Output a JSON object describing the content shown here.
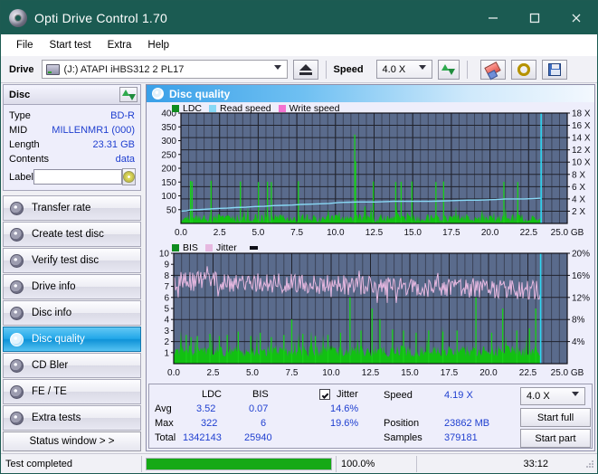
{
  "window": {
    "title": "Opti Drive Control 1.70",
    "icon": "disc-icon",
    "buttons": {
      "minimize": "minimize-icon",
      "maximize": "maximize-icon",
      "close": "close-icon"
    }
  },
  "menu": {
    "items": [
      "File",
      "Start test",
      "Extra",
      "Help"
    ]
  },
  "toolbar": {
    "drive_label": "Drive",
    "drive_value": "(J:)   ATAPI iHBS312   2 PL17",
    "eject_icon": "eject-icon",
    "speed_label": "Speed",
    "speed_value": "4.0 X",
    "refresh_icon": "refresh-arrows-icon",
    "erase_icon": "eraser-icon",
    "tools_icon": "wrench-icon",
    "save_icon": "floppy-save-icon"
  },
  "disc": {
    "header": "Disc",
    "refresh_icon": "refresh-arrows-icon",
    "rows": [
      {
        "key": "Type",
        "value": "BD-R"
      },
      {
        "key": "MID",
        "value": "MILLENMR1 (000)"
      },
      {
        "key": "Length",
        "value": "23.31 GB"
      },
      {
        "key": "Contents",
        "value": "data"
      }
    ],
    "label_key": "Label",
    "label_value": "",
    "label_placeholder": "",
    "label_button_icon": "disc-icon"
  },
  "nav": {
    "items": [
      {
        "label": "Transfer rate",
        "icon": "disc-icon",
        "active": false
      },
      {
        "label": "Create test disc",
        "icon": "disc-icon",
        "active": false
      },
      {
        "label": "Verify test disc",
        "icon": "disc-icon",
        "active": false
      },
      {
        "label": "Drive info",
        "icon": "disc-icon",
        "active": false
      },
      {
        "label": "Disc info",
        "icon": "disc-icon",
        "active": false
      },
      {
        "label": "Disc quality",
        "icon": "disc-icon",
        "active": true
      },
      {
        "label": "CD Bler",
        "icon": "disc-icon",
        "active": false
      },
      {
        "label": "FE / TE",
        "icon": "disc-icon",
        "active": false
      },
      {
        "label": "Extra tests",
        "icon": "disc-icon",
        "active": false
      }
    ],
    "status_window": "Status window > >"
  },
  "panel": {
    "title": "Disc quality",
    "icon": "disc-icon"
  },
  "stats": {
    "col_ldc": "LDC",
    "col_bis": "BIS",
    "jitter_label": "Jitter",
    "jitter_checked": true,
    "row_avg": "Avg",
    "row_max": "Max",
    "row_total": "Total",
    "ldc_avg": "3.52",
    "ldc_max": "322",
    "ldc_total": "1342143",
    "bis_avg": "0.07",
    "bis_max": "6",
    "bis_total": "25940",
    "jitter_avg": "14.6%",
    "jitter_max": "19.6%",
    "speed_label": "Speed",
    "speed_value": "4.19 X",
    "position_label": "Position",
    "position_value": "23862 MB",
    "samples_label": "Samples",
    "samples_value": "379181",
    "speed_select": "4.0 X",
    "start_full": "Start full",
    "start_part": "Start part"
  },
  "statusbar": {
    "message": "Test completed",
    "progress_percent": 100.0,
    "progress_text": "100.0%",
    "elapsed": "33:12"
  },
  "colors": {
    "titlebar": "#1b5b52",
    "accent": "#1f3fd0",
    "ldc_green": "#12c012",
    "bis_green": "#12c012",
    "read_speed": "#88d8f5",
    "write_speed": "#f472d0",
    "jitter_pink": "#e6b8e0",
    "plot_bg": "#5a6b8c",
    "grid": "#20222c",
    "progress": "#16a916"
  },
  "chart_data": [
    {
      "type": "line",
      "id": "ldc-chart",
      "title": "",
      "xlabel": "GB",
      "ylabel": "",
      "xlim": [
        0,
        25
      ],
      "xticks": [
        0.0,
        2.5,
        5.0,
        7.5,
        10.0,
        12.5,
        15.0,
        17.5,
        20.0,
        22.5,
        25.0
      ],
      "xticklabels": [
        "0.0",
        "2.5",
        "5.0",
        "7.5",
        "10.0",
        "12.5",
        "15.0",
        "17.5",
        "20.0",
        "22.5",
        "25.0 GB"
      ],
      "ylim": [
        0,
        400
      ],
      "yticks": [
        50,
        100,
        150,
        200,
        250,
        300,
        350,
        400
      ],
      "yticklabels": [
        "50",
        "100",
        "150",
        "200",
        "250",
        "300",
        "350",
        "400"
      ],
      "y2lim": [
        0,
        18
      ],
      "y2ticks": [
        2,
        4,
        6,
        8,
        10,
        12,
        14,
        16,
        18
      ],
      "y2ticklabels": [
        "2 X",
        "4 X",
        "6 X",
        "8 X",
        "10 X",
        "12 X",
        "14 X",
        "16 X",
        "18 X"
      ],
      "legend": [
        "LDC",
        "Read speed",
        "Write speed"
      ],
      "legend_colors": [
        "#0f8c1f",
        "#88d8f5",
        "#f472d0"
      ],
      "legend_position": "top-left",
      "grid": true,
      "data_end_gb": 23.31,
      "series": [
        {
          "name": "LDC",
          "kind": "bars",
          "note": "dense noise floor ~5-35 with sparse spikes",
          "baseline_min": 4,
          "baseline_max": 36,
          "spikes": [
            [
              0.62,
              154
            ],
            [
              0.72,
              152
            ],
            [
              1.95,
              155
            ],
            [
              3.85,
              152
            ],
            [
              5.02,
              150
            ],
            [
              5.6,
              151
            ],
            [
              5.85,
              150
            ],
            [
              7.6,
              153
            ],
            [
              11.25,
              322
            ],
            [
              11.3,
              225
            ],
            [
              12.45,
              152
            ],
            [
              13.9,
              150
            ],
            [
              14.25,
              151
            ],
            [
              14.95,
              152
            ],
            [
              16.5,
              150
            ],
            [
              17.0,
              152
            ],
            [
              20.9,
              151
            ],
            [
              21.8,
              150
            ]
          ]
        },
        {
          "name": "Read speed",
          "kind": "line",
          "axis": "right",
          "points": [
            [
              0.0,
              2.0
            ],
            [
              0.35,
              2.05
            ],
            [
              0.6,
              2.2
            ],
            [
              1.2,
              2.25
            ],
            [
              1.8,
              2.35
            ],
            [
              2.4,
              2.45
            ],
            [
              3.0,
              2.5
            ],
            [
              3.6,
              2.6
            ],
            [
              4.2,
              2.65
            ],
            [
              4.8,
              2.75
            ],
            [
              5.4,
              2.8
            ],
            [
              6.0,
              2.9
            ],
            [
              6.6,
              2.95
            ],
            [
              7.2,
              3.0
            ],
            [
              7.8,
              3.1
            ],
            [
              8.4,
              3.15
            ],
            [
              9.0,
              3.2
            ],
            [
              9.6,
              3.25
            ],
            [
              10.2,
              3.4
            ],
            [
              10.8,
              3.45
            ],
            [
              11.4,
              3.5
            ],
            [
              12.0,
              3.5
            ],
            [
              12.6,
              3.5
            ],
            [
              13.2,
              3.55
            ],
            [
              13.8,
              3.6
            ],
            [
              14.4,
              3.6
            ],
            [
              15.0,
              3.6
            ],
            [
              15.6,
              3.6
            ],
            [
              16.2,
              3.6
            ],
            [
              16.8,
              3.65
            ],
            [
              17.4,
              3.7
            ],
            [
              18.0,
              3.75
            ],
            [
              18.6,
              3.8
            ],
            [
              19.2,
              3.8
            ],
            [
              19.8,
              3.85
            ],
            [
              20.4,
              3.9
            ],
            [
              21.0,
              4.0
            ],
            [
              21.6,
              4.0
            ],
            [
              22.2,
              4.0
            ],
            [
              22.8,
              4.05
            ],
            [
              23.2,
              4.1
            ],
            [
              23.31,
              4.1
            ]
          ]
        },
        {
          "name": "Write speed",
          "kind": "line",
          "axis": "right",
          "points": []
        }
      ],
      "end_marker": {
        "x": 23.31,
        "color": "#2fd5f0",
        "note": "vertical cyan end-of-test line"
      }
    },
    {
      "type": "line",
      "id": "bis-jitter-chart",
      "title": "",
      "xlabel": "GB",
      "xlim": [
        0,
        25
      ],
      "xticks": [
        0.0,
        2.5,
        5.0,
        7.5,
        10.0,
        12.5,
        15.0,
        17.5,
        20.0,
        22.5,
        25.0
      ],
      "xticklabels": [
        "0.0",
        "2.5",
        "5.0",
        "7.5",
        "10.0",
        "12.5",
        "15.0",
        "17.5",
        "20.0",
        "22.5",
        "25.0 GB"
      ],
      "ylim": [
        0,
        10
      ],
      "yticks": [
        1,
        2,
        3,
        4,
        5,
        6,
        7,
        8,
        9,
        10
      ],
      "yticklabels": [
        "1",
        "2",
        "3",
        "4",
        "5",
        "6",
        "7",
        "8",
        "9",
        "10"
      ],
      "y2lim": [
        0,
        20
      ],
      "y2ticks": [
        4,
        8,
        12,
        16,
        20
      ],
      "y2ticklabels": [
        "4%",
        "8%",
        "12%",
        "16%",
        "20%"
      ],
      "legend": [
        "BIS",
        "Jitter"
      ],
      "legend_colors": [
        "#0f8c1f",
        "#e6b8e0"
      ],
      "legend_position": "top-left",
      "grid": true,
      "data_end_gb": 23.31,
      "series": [
        {
          "name": "BIS",
          "kind": "bars",
          "note": "dense fill to ~1.6 with frequent spikes to 2-3 and occasional 4-6",
          "baseline_min": 0.6,
          "baseline_max": 1.7,
          "spikes": [
            [
              0.8,
              2.6
            ],
            [
              1.1,
              2.4
            ],
            [
              1.5,
              2.5
            ],
            [
              2.3,
              2.7
            ],
            [
              2.9,
              2.5
            ],
            [
              3.4,
              2.6
            ],
            [
              4.1,
              2.9
            ],
            [
              4.9,
              2.5
            ],
            [
              5.5,
              2.8
            ],
            [
              6.2,
              2.4
            ],
            [
              7.0,
              2.6
            ],
            [
              7.5,
              4.0
            ],
            [
              8.2,
              2.7
            ],
            [
              9.0,
              2.5
            ],
            [
              9.8,
              2.6
            ],
            [
              10.6,
              2.8
            ],
            [
              11.2,
              6.0
            ],
            [
              11.9,
              3.0
            ],
            [
              12.6,
              5.0
            ],
            [
              13.1,
              4.0
            ],
            [
              13.9,
              3.1
            ],
            [
              14.6,
              3.0
            ],
            [
              15.4,
              2.8
            ],
            [
              16.2,
              3.0
            ],
            [
              17.1,
              2.9
            ],
            [
              18.0,
              3.0
            ],
            [
              19.2,
              6.0
            ],
            [
              20.2,
              2.8
            ],
            [
              20.9,
              5.0
            ],
            [
              21.8,
              3.0
            ],
            [
              22.6,
              3.2
            ],
            [
              23.0,
              5.0
            ]
          ]
        },
        {
          "name": "Jitter",
          "kind": "line",
          "axis": "right",
          "note": "noisy band averaging ~14.6% declining slightly toward end",
          "mean_start_pct": 15.0,
          "mean_end_pct": 13.4,
          "noise_amplitude_pct": 1.8,
          "max_pct": 19.6,
          "min_pct": 11.0
        }
      ],
      "end_marker": {
        "x": 23.31,
        "color": "#2fd5f0",
        "note": "vertical cyan end-of-test line"
      }
    }
  ]
}
